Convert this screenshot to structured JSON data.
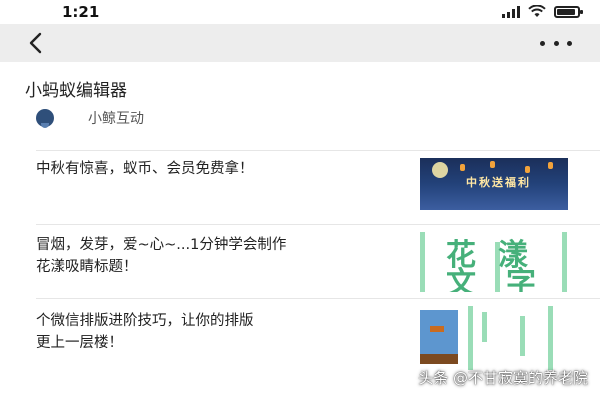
{
  "status_bar": {
    "time": "1:21"
  },
  "nav": {
    "back_icon": "chevron-left-icon",
    "more_icon": "more-dots-icon"
  },
  "page": {
    "title": "小蚂蚁编辑器"
  },
  "publisher": {
    "name": "小鲸互动"
  },
  "articles": [
    {
      "title": "中秋有惊喜，蚁币、会员免费拿！",
      "thumb_text": "中秋送福利"
    },
    {
      "title_line1": "冒烟，发芽，爱~心~...1分钟学会制作",
      "title_line2": "花漾吸睛标题！",
      "thumb_chars": [
        "花",
        "漾",
        "文",
        "字"
      ]
    },
    {
      "title_line1": "个微信排版进阶技巧，让你的排版",
      "title_line2": "更上一层楼！"
    }
  ],
  "watermark": "头条 @不甘寂寞的养老院"
}
